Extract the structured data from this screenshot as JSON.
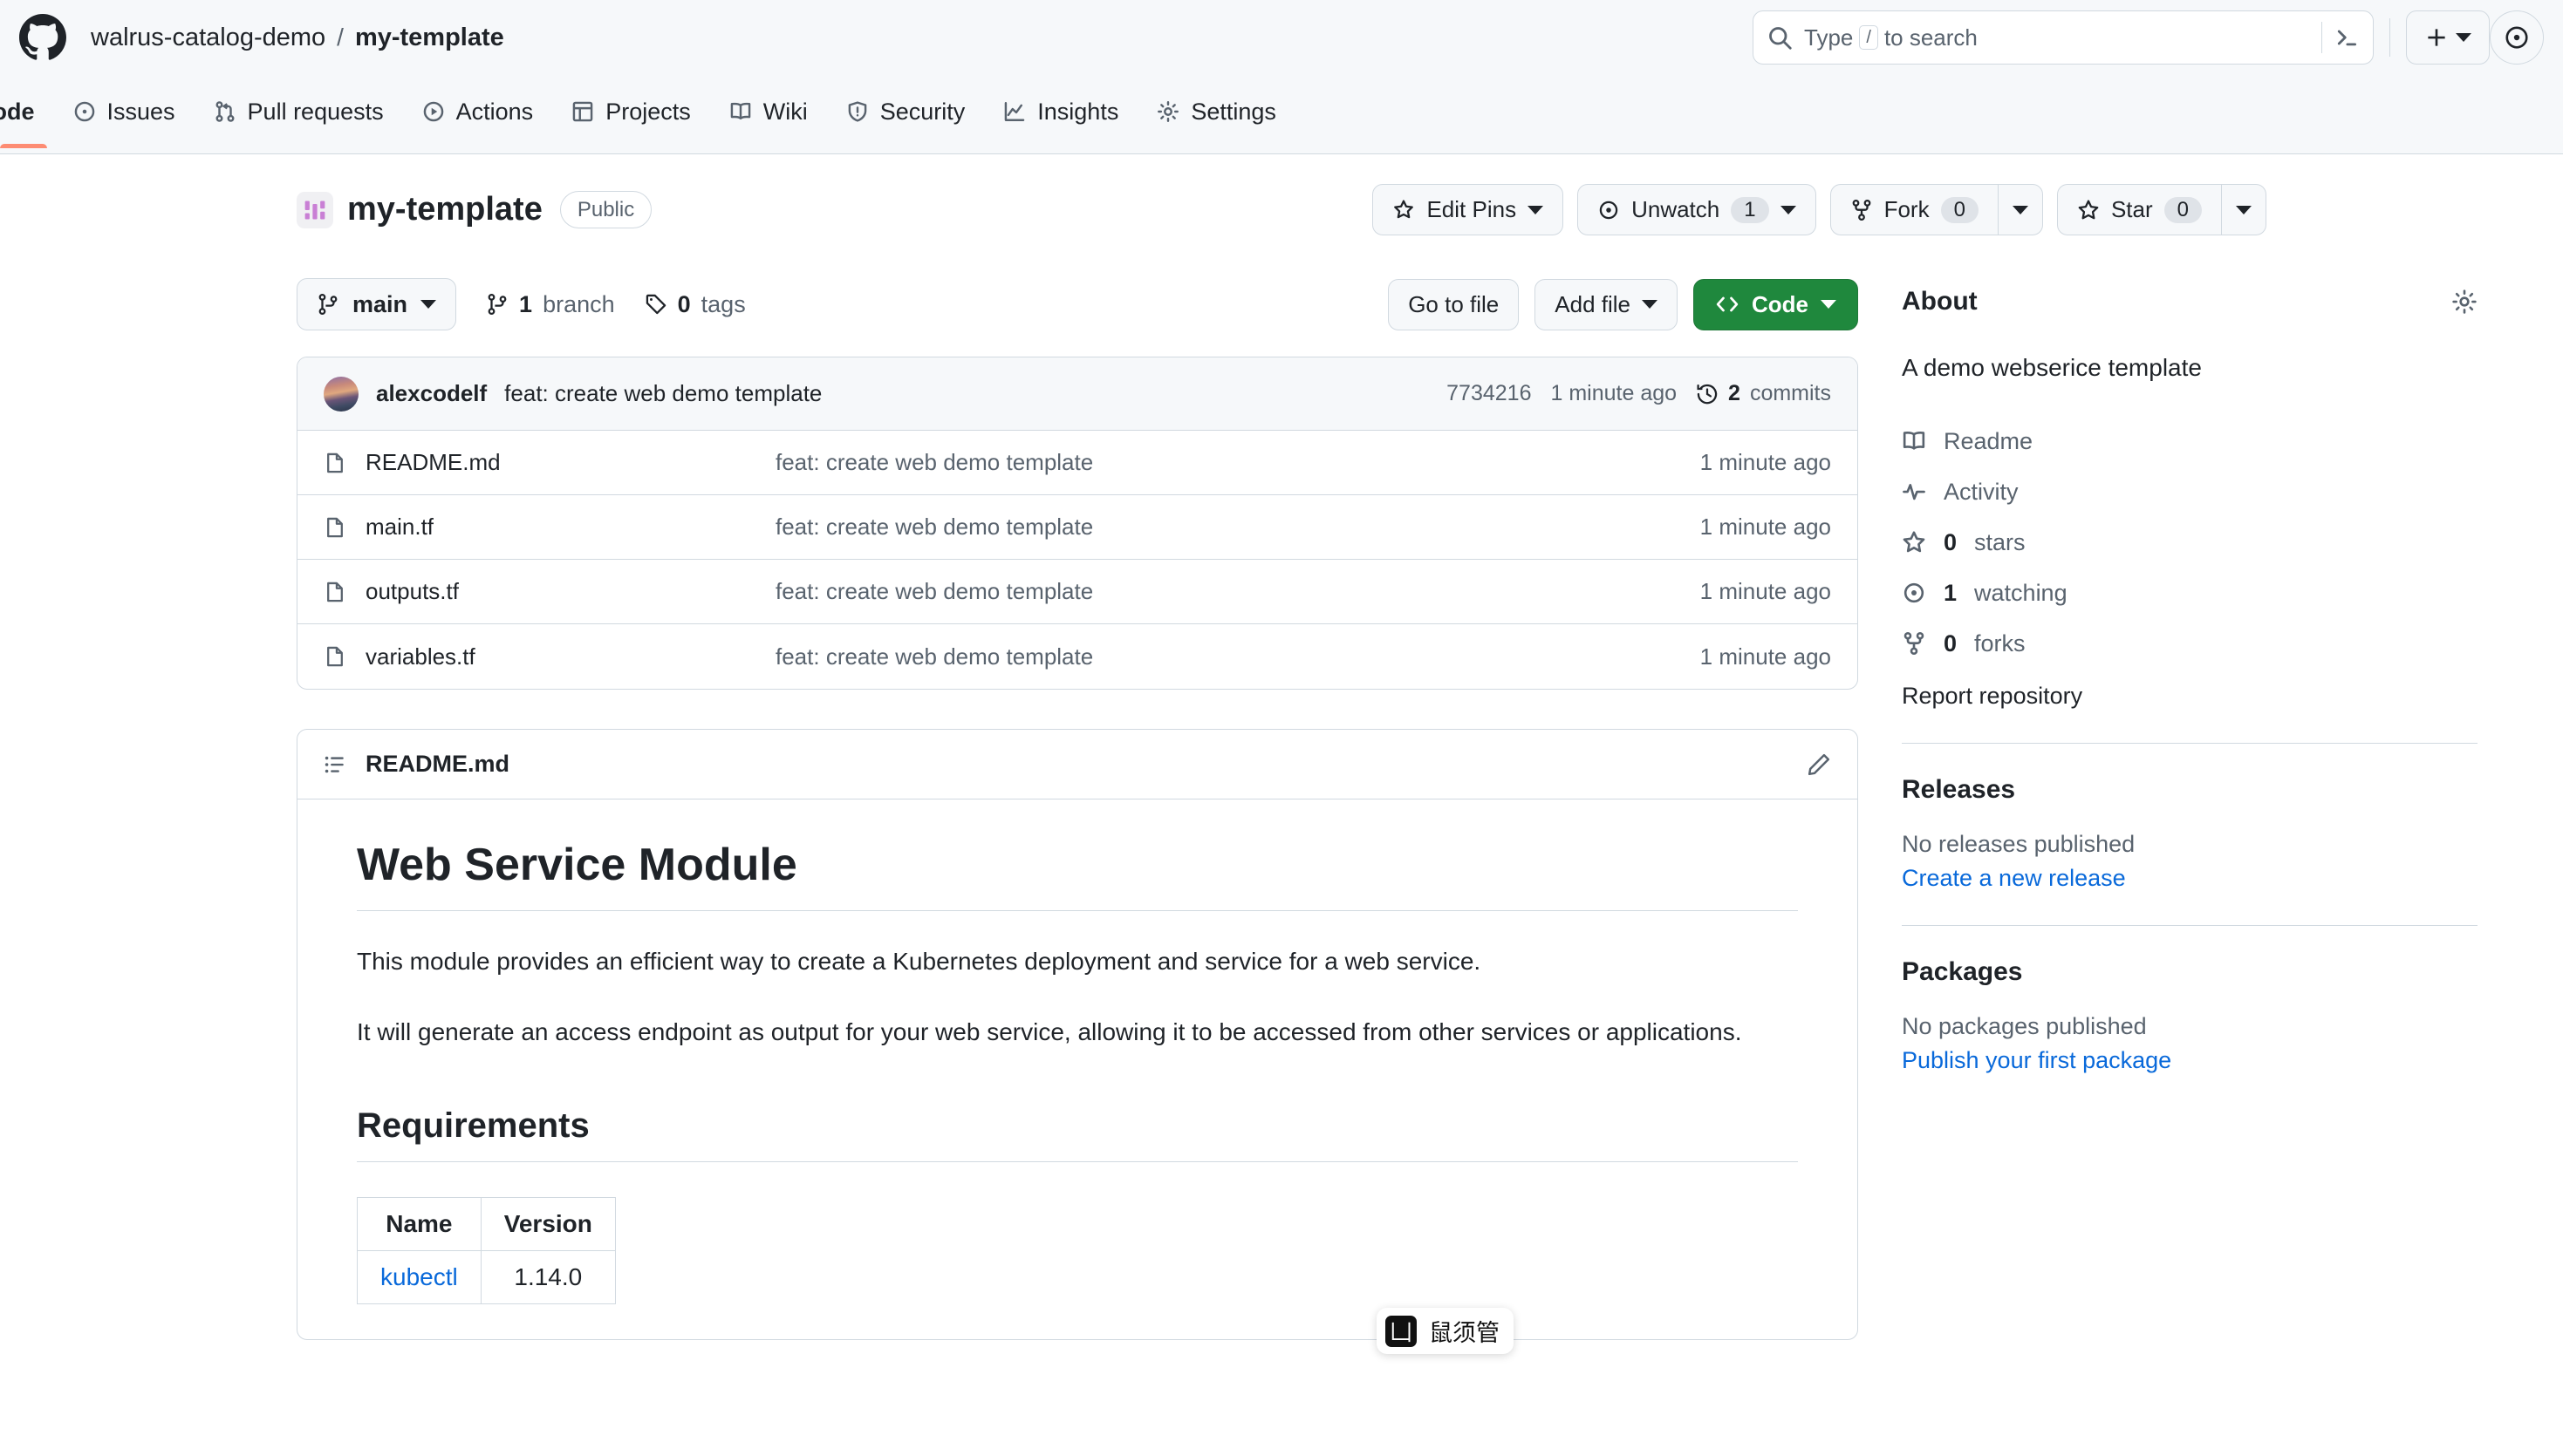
{
  "header": {
    "logo_icon": "github-mark-icon",
    "breadcrumb": {
      "owner": "walrus-catalog-demo",
      "separator": "/",
      "repo": "my-template"
    },
    "search": {
      "icon": "search-icon",
      "placeholder_prefix": "Type",
      "placeholder_key": "/",
      "placeholder_suffix": "to search",
      "terminal_icon": "command-palette-icon"
    },
    "create_new_button": {
      "icon": "plus-icon",
      "caret": "chevron-down-icon"
    },
    "account_button": {
      "icon": "user-avatar-icon"
    }
  },
  "repo_nav": {
    "tabs": [
      {
        "label": "Code",
        "icon": "code-icon",
        "active": true
      },
      {
        "label": "Issues",
        "icon": "issue-opened-icon",
        "active": false
      },
      {
        "label": "Pull requests",
        "icon": "git-pull-request-icon",
        "active": false
      },
      {
        "label": "Actions",
        "icon": "play-icon",
        "active": false
      },
      {
        "label": "Projects",
        "icon": "table-icon",
        "active": false
      },
      {
        "label": "Wiki",
        "icon": "book-icon",
        "active": false
      },
      {
        "label": "Security",
        "icon": "shield-icon",
        "active": false
      },
      {
        "label": "Insights",
        "icon": "graph-icon",
        "active": false
      },
      {
        "label": "Settings",
        "icon": "gear-icon",
        "active": false
      }
    ],
    "active_underline_color": "#fd8c73"
  },
  "repo_header": {
    "icon": "repo-template-icon",
    "icon_color": "#c97fd5",
    "name": "my-template",
    "visibility": "Public",
    "actions": {
      "edit_pins": {
        "label": "Edit Pins",
        "icon": "pin-icon",
        "caret": "chevron-down-icon"
      },
      "watch": {
        "label": "Unwatch",
        "icon": "eye-icon",
        "count": "1",
        "caret": "chevron-down-icon"
      },
      "fork": {
        "label": "Fork",
        "icon": "repo-forked-icon",
        "count": "0",
        "caret": "chevron-down-icon"
      },
      "star": {
        "label": "Star",
        "icon": "star-icon",
        "count": "0",
        "caret": "chevron-down-icon"
      }
    }
  },
  "file_actions": {
    "branch": {
      "label": "main",
      "icon": "git-branch-icon",
      "caret": "chevron-down-icon"
    },
    "branch_count": {
      "number": "1",
      "label": "branch",
      "icon": "git-branch-icon"
    },
    "tag_count": {
      "number": "0",
      "label": "tags",
      "icon": "tag-icon"
    },
    "go_to_file": "Go to file",
    "add_file": {
      "label": "Add file",
      "caret": "chevron-down-icon"
    },
    "code_button": {
      "label": "Code",
      "icon": "code-brackets-icon",
      "caret": "chevron-down-icon",
      "color": "#1f883d"
    }
  },
  "commit_bar": {
    "avatar": "user-avatar",
    "author": "alexcodelf",
    "message": "feat: create web demo template",
    "sha": "7734216",
    "time": "1 minute ago",
    "commits_icon": "history-icon",
    "commits_number": "2",
    "commits_label": "commits"
  },
  "files": [
    {
      "icon": "file-icon",
      "name": "README.md",
      "commit": "feat: create web demo template",
      "time": "1 minute ago"
    },
    {
      "icon": "file-icon",
      "name": "main.tf",
      "commit": "feat: create web demo template",
      "time": "1 minute ago"
    },
    {
      "icon": "file-icon",
      "name": "outputs.tf",
      "commit": "feat: create web demo template",
      "time": "1 minute ago"
    },
    {
      "icon": "file-icon",
      "name": "variables.tf",
      "commit": "feat: create web demo template",
      "time": "1 minute ago"
    }
  ],
  "readme": {
    "header_icon": "list-unordered-icon",
    "header_title": "README.md",
    "edit_icon": "pencil-icon",
    "h1": "Web Service Module",
    "paragraph1": "This module provides an efficient way to create a Kubernetes deployment and service for a web service.",
    "paragraph2": "It will generate an access endpoint as output for your web service, allowing it to be accessed from other services or applications.",
    "h2": "Requirements",
    "table": {
      "columns": [
        "Name",
        "Version"
      ],
      "rows": [
        {
          "name": "kubectl",
          "version": "1.14.0"
        }
      ]
    }
  },
  "sidebar": {
    "about_title": "About",
    "gear_icon": "gear-icon",
    "description": "A demo webserice template",
    "links": [
      {
        "icon": "book-icon",
        "label": "Readme",
        "bold": ""
      },
      {
        "icon": "pulse-icon",
        "label": "Activity",
        "bold": ""
      },
      {
        "icon": "star-icon",
        "label": "stars",
        "bold": "0"
      },
      {
        "icon": "eye-icon",
        "label": "watching",
        "bold": "1"
      },
      {
        "icon": "repo-forked-icon",
        "label": "forks",
        "bold": "0"
      }
    ],
    "report": "Report repository",
    "releases": {
      "title": "Releases",
      "empty": "No releases published",
      "cta": "Create a new release"
    },
    "packages": {
      "title": "Packages",
      "empty": "No packages published",
      "cta": "Publish your first package"
    }
  },
  "ime_badge": {
    "glyph": "凵",
    "label": "鼠须管"
  }
}
